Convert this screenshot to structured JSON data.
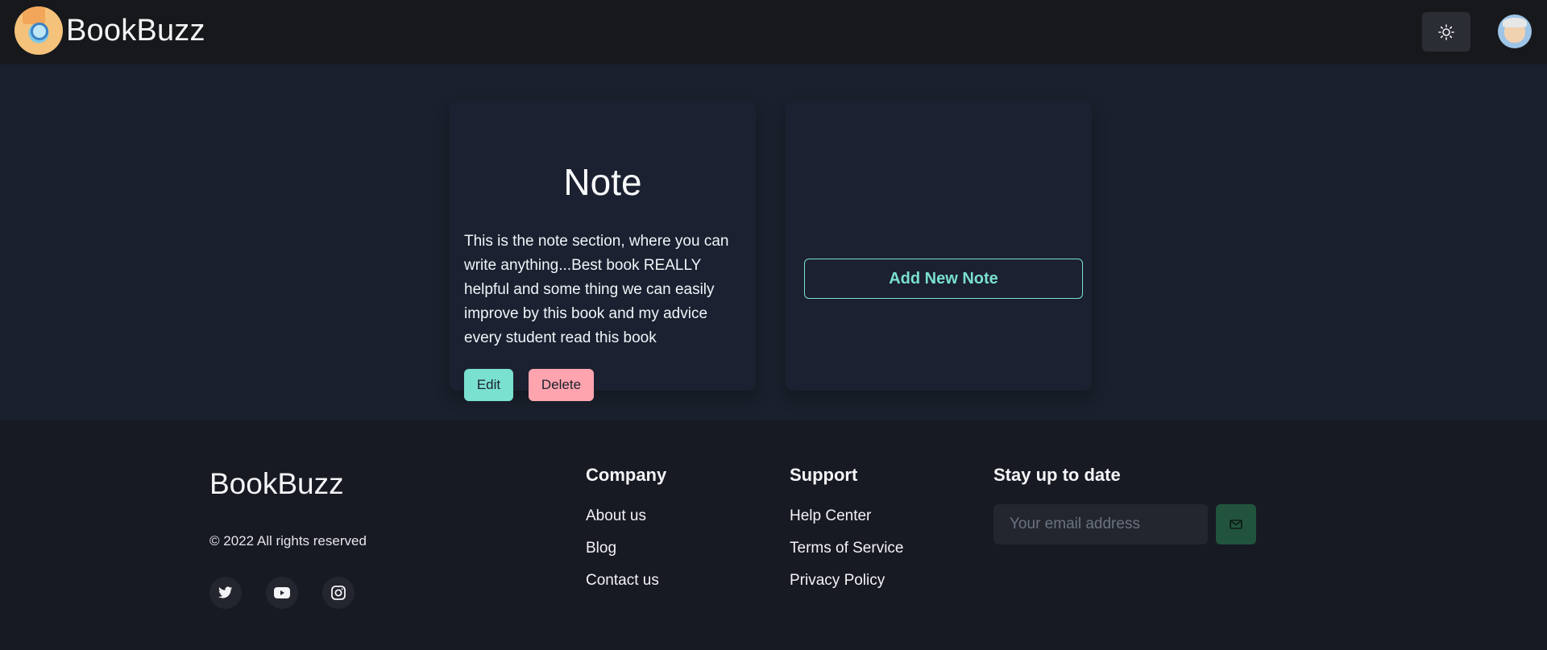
{
  "header": {
    "brand": "BookBuzz",
    "theme_toggle_icon": "sun-icon",
    "avatar_icon": "user-avatar"
  },
  "note": {
    "title": "Note",
    "text": "This is the note section, where you can write anything...Best book REALLY helpful and some thing we can easily improve by this book and my advice every student read this book",
    "edit_label": "Edit",
    "delete_label": "Delete"
  },
  "add_note": {
    "label": "Add New Note"
  },
  "footer": {
    "brand": "BookBuzz",
    "copyright": "© 2022 All rights reserved",
    "social": [
      "twitter-icon",
      "youtube-icon",
      "instagram-icon"
    ],
    "company": {
      "title": "Company",
      "links": [
        "About us",
        "Blog",
        "Contact us"
      ]
    },
    "support": {
      "title": "Support",
      "links": [
        "Help Center",
        "Terms of Service",
        "Privacy Policy"
      ]
    },
    "newsletter": {
      "title": "Stay up to date",
      "placeholder": "Your email address",
      "send_icon": "mail-icon"
    }
  },
  "colors": {
    "accent": "#7ae0cf",
    "danger": "#fda4af",
    "send": "#22543d"
  }
}
